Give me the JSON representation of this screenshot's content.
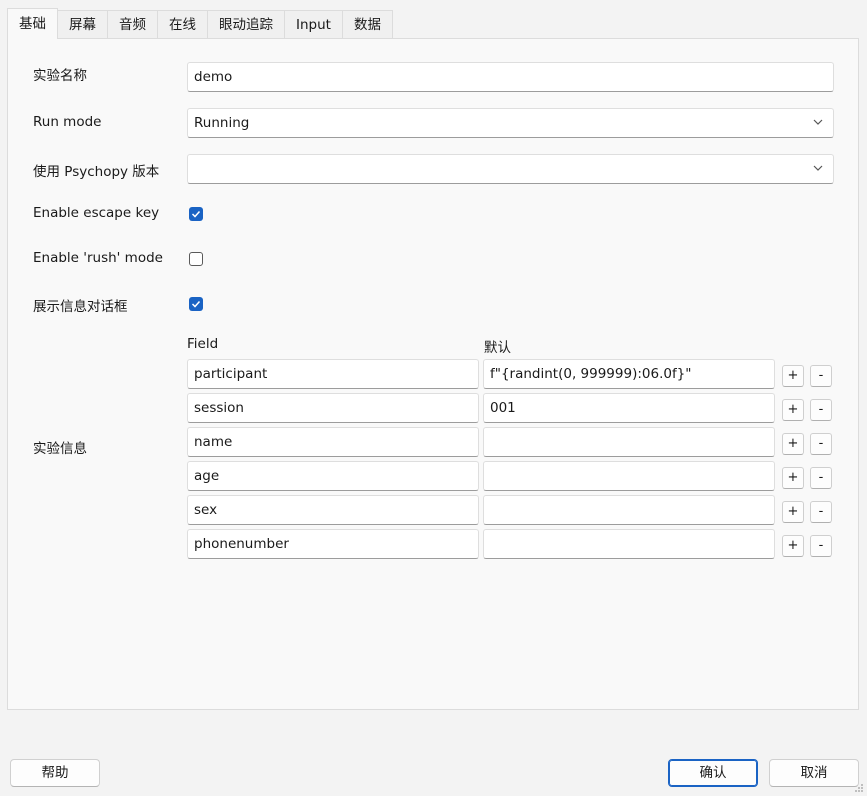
{
  "tabs": [
    {
      "label": "基础",
      "active": true
    },
    {
      "label": "屏幕"
    },
    {
      "label": "音频"
    },
    {
      "label": "在线"
    },
    {
      "label": "眼动追踪"
    },
    {
      "label": "Input"
    },
    {
      "label": "数据"
    }
  ],
  "form": {
    "exp_name_label": "实验名称",
    "exp_name_value": "demo",
    "run_mode_label": "Run mode",
    "run_mode_value": "Running",
    "psychopy_version_label": "使用 Psychopy 版本",
    "psychopy_version_value": "",
    "escape_key_label": "Enable escape key",
    "escape_key_checked": true,
    "rush_mode_label": "Enable 'rush' mode",
    "rush_mode_checked": false,
    "show_info_label": "展示信息对话框",
    "show_info_checked": true,
    "exp_info_label": "实验信息",
    "field_header": "Field",
    "default_header": "默认",
    "add_label": "+",
    "remove_label": "-",
    "rows": [
      {
        "field": "participant",
        "default": "f\"{randint(0, 999999):06.0f}\""
      },
      {
        "field": "session",
        "default": "001"
      },
      {
        "field": "name",
        "default": ""
      },
      {
        "field": "age",
        "default": ""
      },
      {
        "field": "sex",
        "default": ""
      },
      {
        "field": "phonenumber",
        "default": ""
      }
    ]
  },
  "buttons": {
    "help": "帮助",
    "ok": "确认",
    "cancel": "取消"
  },
  "colors": {
    "accent": "#1a63c4",
    "panel_bg": "#f9f9f9",
    "window_bg": "#f3f3f3"
  }
}
